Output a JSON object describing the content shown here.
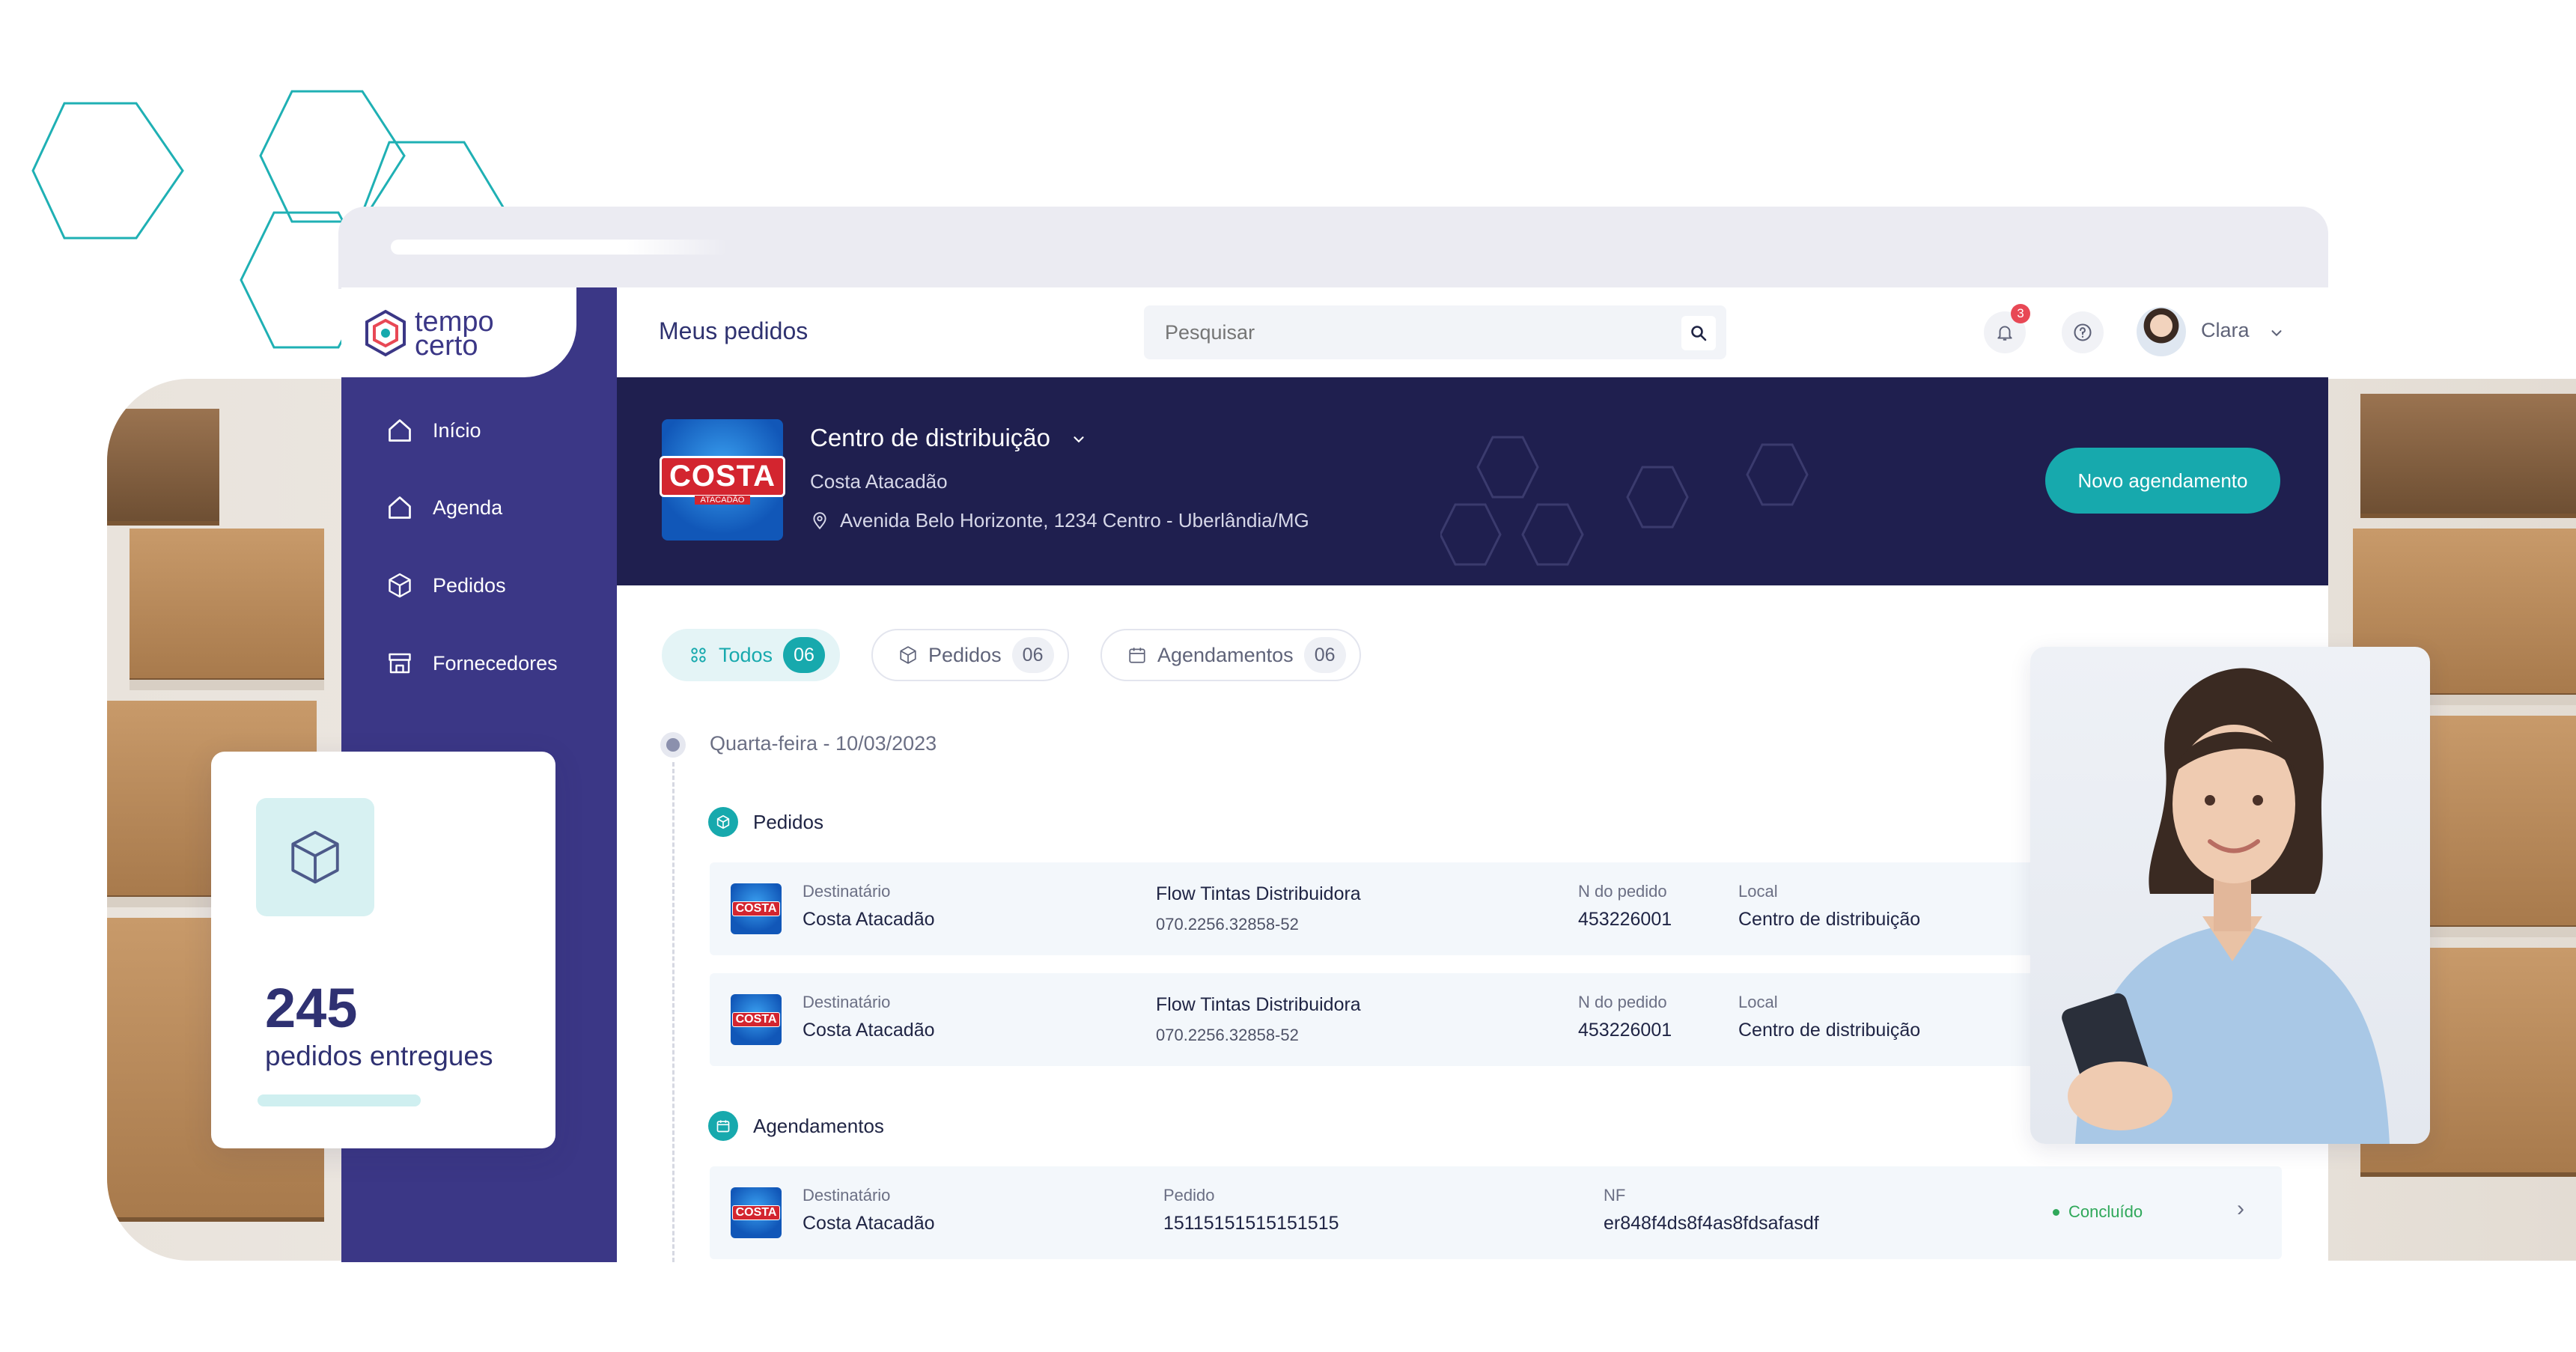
{
  "brand": {
    "logo_line1": "tempo",
    "logo_line2": "certo"
  },
  "header": {
    "page_title": "Meus pedidos",
    "search_placeholder": "Pesquisar",
    "notifications_count": "3",
    "user_name": "Clara"
  },
  "sidebar": {
    "items": [
      {
        "label": "Início",
        "icon": "home-icon"
      },
      {
        "label": "Agenda",
        "icon": "home-icon"
      },
      {
        "label": "Pedidos",
        "icon": "box-icon"
      },
      {
        "label": "Fornecedores",
        "icon": "store-icon"
      }
    ]
  },
  "hero": {
    "title": "Centro de distribuição",
    "subtitle": "Costa Atacadão",
    "address": "Avenida Belo Horizonte, 1234 Centro - Uberlândia/MG",
    "logo_word": "COSTA",
    "logo_sub": "ATACADÃO",
    "cta": "Novo agendamento"
  },
  "filters": [
    {
      "label": "Todos",
      "count": "06"
    },
    {
      "label": "Pedidos",
      "count": "06"
    },
    {
      "label": "Agendamentos",
      "count": "06"
    }
  ],
  "timeline": {
    "date": "Quarta-feira - 10/03/2023",
    "pedidos_title": "Pedidos",
    "agendamentos_title": "Agendamentos",
    "pedidos": [
      {
        "dest_label": "Destinatário",
        "dest": "Costa Atacadão",
        "supplier": "Flow Tintas Distribuidora",
        "cnpj": "070.2256.32858-52",
        "order_label": "N do pedido",
        "order": "453226001",
        "local_label": "Local",
        "local": "Centro de distribuição"
      },
      {
        "dest_label": "Destinatário",
        "dest": "Costa Atacadão",
        "supplier": "Flow Tintas Distribuidora",
        "cnpj": "070.2256.32858-52",
        "order_label": "N do pedido",
        "order": "453226001",
        "local_label": "Local",
        "local": "Centro de distribuição"
      }
    ],
    "agendamentos": [
      {
        "dest_label": "Destinatário",
        "dest": "Costa Atacadão",
        "order_label": "Pedido",
        "order": "15115151515151515",
        "nf_label": "NF",
        "nf": "er848f4ds8f4as8fdsafasdf",
        "status": "Concluído"
      }
    ]
  },
  "stat": {
    "number": "245",
    "label": "pedidos entregues"
  },
  "colors": {
    "primary": "#3b3786",
    "accent": "#17a9ad",
    "hero": "#1f1f4f",
    "success": "#2fa85a",
    "badge": "#e84855"
  }
}
